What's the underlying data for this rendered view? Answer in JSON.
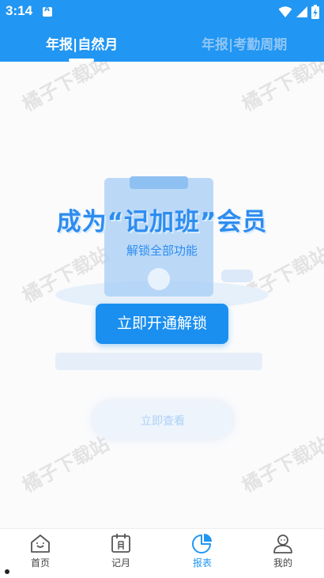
{
  "status_bar": {
    "time": "3:14",
    "notification_letter": "A",
    "icons": [
      "wifi-icon",
      "signal-icon",
      "battery-charging-icon"
    ]
  },
  "header": {
    "tabs": [
      {
        "label": "年报|自然月",
        "active": true
      },
      {
        "label": "年报|考勤周期",
        "active": false
      }
    ]
  },
  "watermark": "橘子下载站",
  "paywall": {
    "title": "成为“记加班”会员",
    "subtitle": "解锁全部功能",
    "button_label": "立即开通解锁",
    "background_pill_label": "立即查看"
  },
  "bottom_nav": {
    "items": [
      {
        "label": "首页",
        "icon": "home-icon",
        "active": false
      },
      {
        "label": "记月",
        "icon": "calendar-icon",
        "active": false
      },
      {
        "label": "报表",
        "icon": "pie-chart-icon",
        "active": true
      },
      {
        "label": "我的",
        "icon": "profile-icon",
        "active": false
      }
    ]
  },
  "colors": {
    "primary": "#2196f3",
    "button": "#1a8fef",
    "title_text": "#2d8cf0",
    "inactive_tab": "#8fc6f5"
  }
}
